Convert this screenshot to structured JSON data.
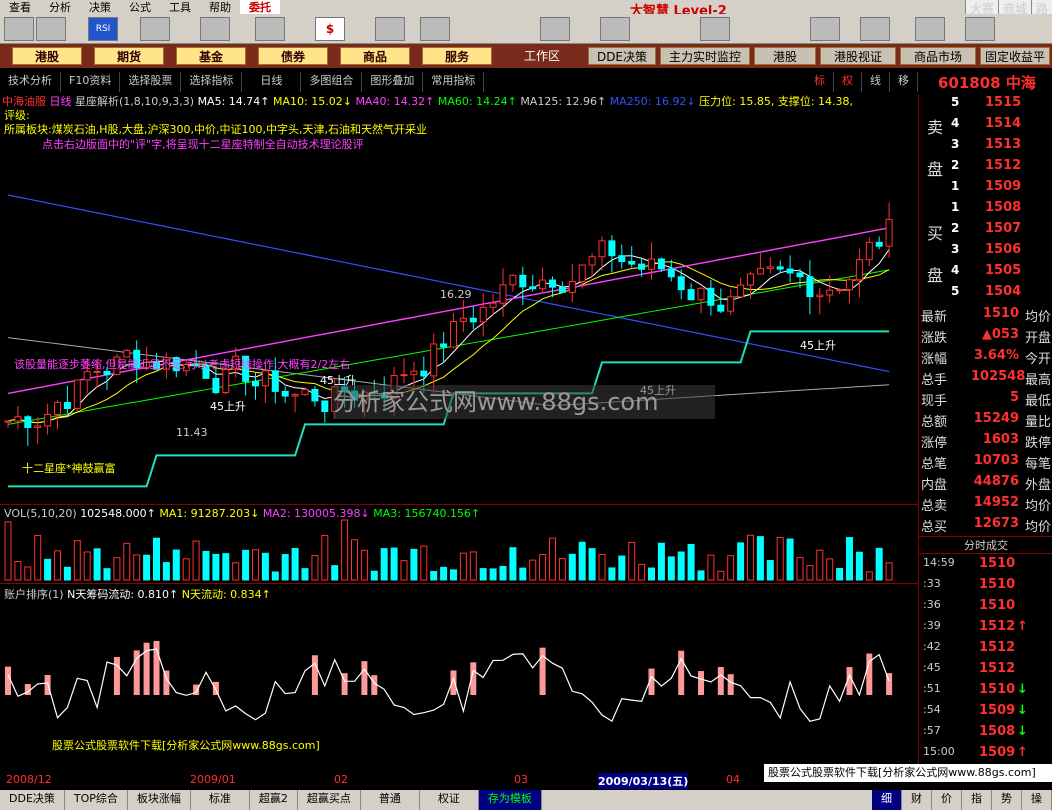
{
  "menu": {
    "items": [
      "查看",
      "分析",
      "决策",
      "公式",
      "工具",
      "帮助"
    ],
    "order": "委托",
    "brand": "大智慧 Level-2",
    "right": [
      "大赛",
      "商城",
      "路"
    ]
  },
  "nav": {
    "items": [
      "港股",
      "期货",
      "基金",
      "债券",
      "商品",
      "服务"
    ],
    "workarea": "工作区",
    "buttons": [
      "DDE决策",
      "主力实时监控",
      "港股",
      "港股视证",
      "商品市场",
      "固定收益平"
    ]
  },
  "tabs": [
    "技术分析",
    "F10资料",
    "选择股票",
    "选择指标",
    "日线",
    "多图组合",
    "图形叠加",
    "常用指标"
  ],
  "tab_right": [
    "标",
    "权",
    "线",
    "移"
  ],
  "stock": {
    "code": "601808",
    "name": "中海"
  },
  "info": {
    "name": "中海油服",
    "period": "日线",
    "indicator": "星座解析",
    "params": "(1,8,10,9,3,3)",
    "ma5": "MA5: 14.74↑",
    "ma10": "MA10: 15.02↓",
    "ma40": "MA40: 14.32↑",
    "ma60": "MA60: 14.24↑",
    "ma125": "MA125: 12.96↑",
    "ma250": "MA250: 16.92↓",
    "pressure": "压力位: 15.85,",
    "support": "支撑位: 14.38,"
  },
  "eval": "评级:",
  "sector": "所属板块:煤炭石油,H股,大盘,沪深300,中价,中证100,中字头,天津,石油和天然气开采业",
  "prompt": "点击右边版面中的\"评\"字,将呈现十二星座特制全自动技术理论股评",
  "annotations": {
    "high": "16.29",
    "low": "11.43",
    "rise": "45上升",
    "msg": "该股量能逐步萎缩,但是能近显不足,可以考虑短线操作,大概有2/2左右",
    "constellation": "十二星座*神鼓赢富"
  },
  "watermark": "分析家公式网www.88gs.com",
  "vol": {
    "label": "VOL(5,10,20)",
    "val": "102548.000↑",
    "ma1": "MA1: 91287.203↓",
    "ma2": "MA2: 130005.398↓",
    "ma3": "MA3: 156740.156↑"
  },
  "acc": {
    "label": "账户排序(1)",
    "n1": "N天筹码流动: 0.810↑",
    "n2": "N天流动: 0.834↑"
  },
  "watermark2": "股票公式股票软件下载[分析家公式网www.88gs.com]",
  "dates": [
    "2008/12",
    "2009/01",
    "02",
    "03",
    "2009/03/13(五)",
    "04"
  ],
  "book": {
    "sell_label": [
      "卖",
      "盘"
    ],
    "buy_label": [
      "买",
      "盘"
    ],
    "sell": [
      {
        "i": "5",
        "p": "1515"
      },
      {
        "i": "4",
        "p": "1514"
      },
      {
        "i": "3",
        "p": "1513"
      },
      {
        "i": "2",
        "p": "1512"
      },
      {
        "i": "1",
        "p": "1509"
      }
    ],
    "buy": [
      {
        "i": "1",
        "p": "1508"
      },
      {
        "i": "2",
        "p": "1507"
      },
      {
        "i": "3",
        "p": "1506"
      },
      {
        "i": "4",
        "p": "1505"
      },
      {
        "i": "5",
        "p": "1504"
      }
    ]
  },
  "stats": [
    {
      "k": "最新",
      "v": "1510",
      "k2": "均价"
    },
    {
      "k": "涨跌",
      "v": "▲053",
      "k2": "开盘"
    },
    {
      "k": "涨幅",
      "v": "3.64%",
      "k2": "今开"
    },
    {
      "k": "总手",
      "v": "102548",
      "k2": "最高"
    },
    {
      "k": "现手",
      "v": "5",
      "k2": "最低"
    },
    {
      "k": "总额",
      "v": "15249",
      "k2": "量比"
    },
    {
      "k": "涨停",
      "v": "1603",
      "k2": "跌停"
    },
    {
      "k": "总笔",
      "v": "10703",
      "k2": "每笔"
    },
    {
      "k": "内盘",
      "v": "44876",
      "k2": "外盘"
    },
    {
      "k": "总卖",
      "v": "14952",
      "k2": "均价"
    },
    {
      "k": "总买",
      "v": "12673",
      "k2": "均价"
    }
  ],
  "ticks_title": "分时成交",
  "ticks": [
    {
      "t": "14:59",
      "p": "1510",
      "a": ""
    },
    {
      "t": ":33",
      "p": "1510",
      "a": ""
    },
    {
      "t": ":36",
      "p": "1510",
      "a": ""
    },
    {
      "t": ":39",
      "p": "1512",
      "a": "↑"
    },
    {
      "t": ":42",
      "p": "1512",
      "a": ""
    },
    {
      "t": ":45",
      "p": "1512",
      "a": ""
    },
    {
      "t": ":51",
      "p": "1510",
      "a": "↓"
    },
    {
      "t": ":54",
      "p": "1509",
      "a": "↓"
    },
    {
      "t": ":57",
      "p": "1508",
      "a": "↓"
    },
    {
      "t": "15:00",
      "p": "1509",
      "a": "↑"
    }
  ],
  "tick_banner": "股票公式股票软件下载[分析家公式网www.88gs.com]",
  "bottom": [
    "DDE决策",
    "TOP综合",
    "板块涨幅",
    "标准",
    "超赢2",
    "超赢买点",
    "普通",
    "权证",
    "存为模板"
  ],
  "bottom_right": [
    "细",
    "财",
    "价",
    "指",
    "势",
    "操"
  ],
  "colors": {
    "bg": "#000000",
    "up": "#ff3030",
    "down": "#00ffff",
    "ma_white": "#ffffff",
    "ma_yellow": "#ffff00",
    "ma_pink": "#ff40ff",
    "ma_green": "#00ff00",
    "ma_blue": "#3050ff"
  }
}
